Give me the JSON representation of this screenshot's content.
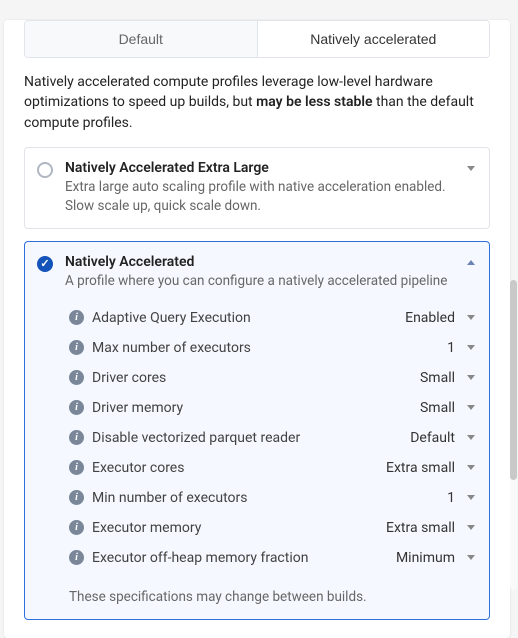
{
  "tabs": {
    "default": "Default",
    "native": "Natively accelerated"
  },
  "description": {
    "pre": "Natively accelerated compute profiles leverage low-level hardware optimizations to speed up builds, but ",
    "bold": "may be less stable",
    "post": " than the default compute profiles."
  },
  "profiles": {
    "xl": {
      "title": "Natively Accelerated Extra Large",
      "sub": "Extra large auto scaling profile with native acceleration enabled. Slow scale up, quick scale down."
    },
    "na": {
      "title": "Natively Accelerated",
      "sub": "A profile where you can configure a natively accelerated pipeline"
    }
  },
  "settings": [
    {
      "label": "Adaptive Query Execution",
      "value": "Enabled"
    },
    {
      "label": "Max number of executors",
      "value": "1"
    },
    {
      "label": "Driver cores",
      "value": "Small"
    },
    {
      "label": "Driver memory",
      "value": "Small"
    },
    {
      "label": "Disable vectorized parquet reader",
      "value": "Default"
    },
    {
      "label": "Executor cores",
      "value": "Extra small"
    },
    {
      "label": "Min number of executors",
      "value": "1"
    },
    {
      "label": "Executor memory",
      "value": "Extra small"
    },
    {
      "label": "Executor off-heap memory fraction",
      "value": "Minimum"
    }
  ],
  "footnote": "These specifications may change between builds.",
  "info_glyph": "i"
}
